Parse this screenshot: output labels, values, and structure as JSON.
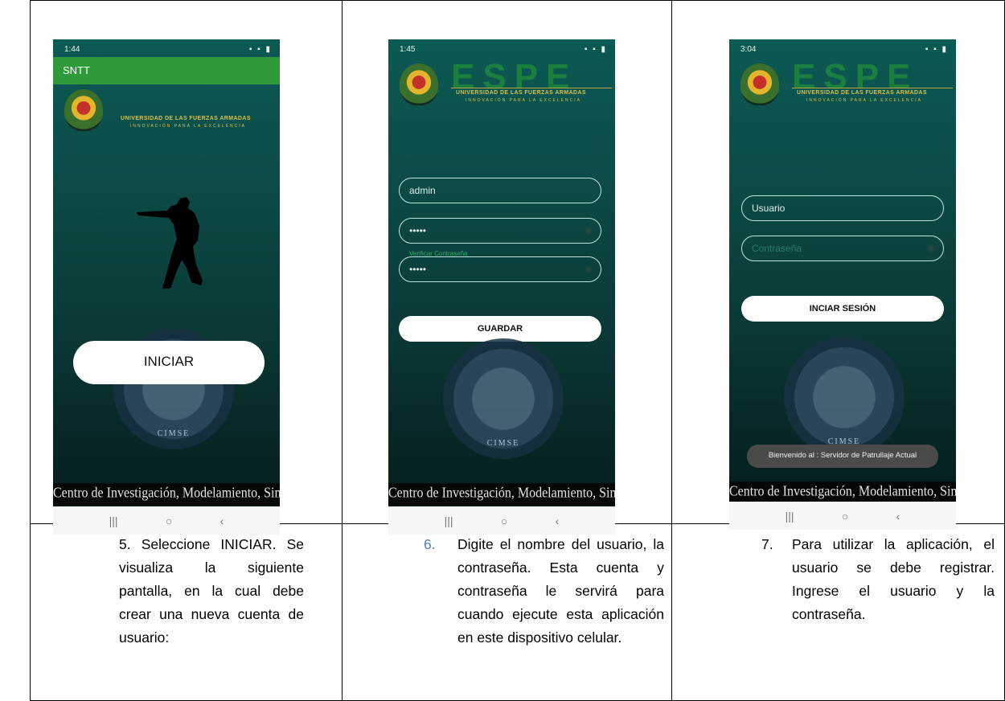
{
  "screens": [
    {
      "status_time": "1:44",
      "app_title": "SNTT",
      "button": "INICIAR",
      "footer_band": "Centro de Investigación, Modelamiento, Simulación y Entrenamiento",
      "seal_text": "CIMSE"
    },
    {
      "status_time": "1:45",
      "username_value": "admin",
      "password_value": "•••••",
      "confirm_label": "Verificar Contraseña",
      "confirm_value": "•••••",
      "button": "GUARDAR",
      "footer_band": "Centro de Investigación, Modelamiento, Simulación y Entrenamiento",
      "seal_text": "CIMSE"
    },
    {
      "status_time": "3:04",
      "username_placeholder": "Usuario",
      "password_placeholder": "Contraseña",
      "button": "INCIAR SESIÓN",
      "toast": "Bienvenido al : Servidor de Patrullaje Actual",
      "footer_band": "Centro de Investigación, Modelamiento, Simulación y Entrenamiento",
      "seal_text": "CIMSE"
    }
  ],
  "branding": {
    "logo_word": "ESPE",
    "university": "UNIVERSIDAD DE LAS FUERZAS ARMADAS",
    "motto": "INNOVACIÓN PARA LA EXCELENCIA"
  },
  "nav": {
    "recent": "|||",
    "home": "○",
    "back": "‹"
  },
  "captions": [
    {
      "number": "5.",
      "text": "Seleccione INICIAR. Se visualiza la siguiente pantalla, en la cual debe crear una nueva cuenta de usuario:"
    },
    {
      "number": "6.",
      "text": "Digite el nombre del usuario, la contraseña. Esta cuenta y contraseña le servirá para cuando ejecute esta aplicación en este dispositivo celular."
    },
    {
      "number": "7.",
      "text": "Para utilizar la aplicación, el usuario se debe registrar. Ingrese el usuario y la contraseña."
    }
  ]
}
